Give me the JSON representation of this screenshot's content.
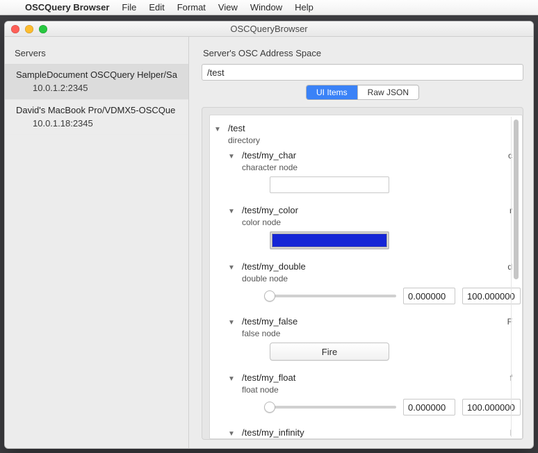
{
  "menubar": {
    "appname": "OSCQuery Browser",
    "items": [
      "File",
      "Edit",
      "Format",
      "View",
      "Window",
      "Help"
    ]
  },
  "window": {
    "title": "OSCQueryBrowser"
  },
  "sidebar": {
    "heading": "Servers",
    "servers": [
      {
        "name": "SampleDocument OSCQuery Helper/Sa",
        "addr": "10.0.1.2:2345",
        "selected": true
      },
      {
        "name": "David's MacBook Pro/VDMX5-OSCQue",
        "addr": "10.0.1.18:2345",
        "selected": false
      }
    ]
  },
  "main": {
    "heading": "Server's OSC Address Space",
    "path": "/test",
    "tabs": {
      "active": "UI Items",
      "other": "Raw JSON"
    }
  },
  "tree": {
    "root": {
      "path": "/test",
      "subtitle": "directory"
    },
    "nodes": [
      {
        "path": "/test/my_char",
        "subtitle": "character node",
        "type_tag": "c",
        "control": "text",
        "value": ""
      },
      {
        "path": "/test/my_color",
        "subtitle": "color node",
        "type_tag": "r",
        "control": "color",
        "value": "#1526D6"
      },
      {
        "path": "/test/my_double",
        "subtitle": "double node",
        "type_tag": "d",
        "control": "slider",
        "value": "0.000000",
        "max": "100.000000"
      },
      {
        "path": "/test/my_false",
        "subtitle": "false node",
        "type_tag": "F",
        "control": "button",
        "button_label": "Fire"
      },
      {
        "path": "/test/my_float",
        "subtitle": "float node",
        "type_tag": "f",
        "control": "slider",
        "value": "0.000000",
        "max": "100.000000"
      },
      {
        "path": "/test/my_infinity",
        "subtitle": "",
        "type_tag": "I",
        "control": "none"
      }
    ]
  }
}
